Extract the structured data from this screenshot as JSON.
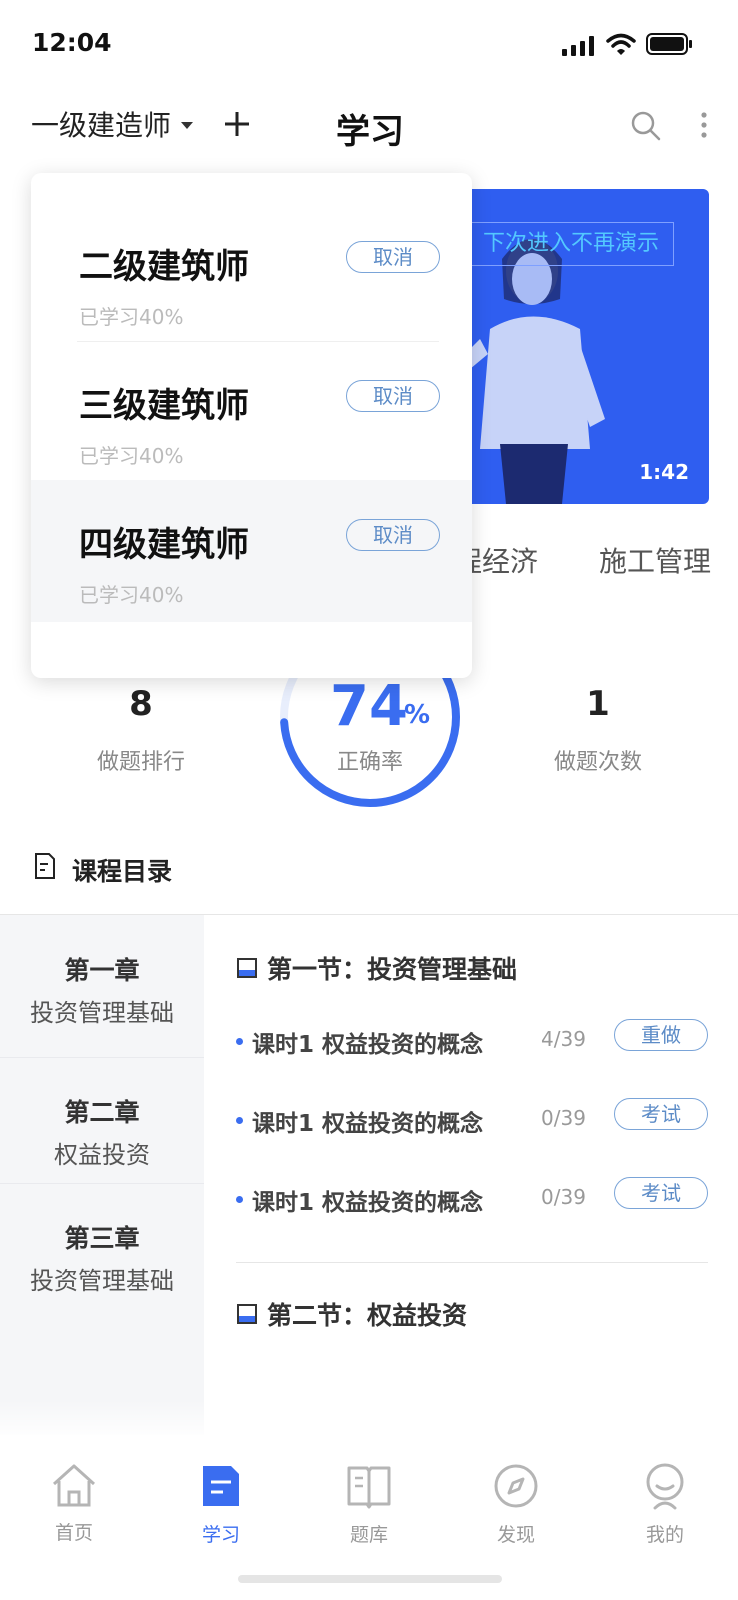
{
  "status_bar": {
    "time": "12:04"
  },
  "header": {
    "exam_selector": "一级建造师",
    "title": "学习"
  },
  "banner": {
    "hint": "下次进入不再演示",
    "duration": "1:42"
  },
  "subject_tabs": [
    "程经济",
    "施工管理"
  ],
  "stats": {
    "rank_value": "8",
    "rank_label": "做题排行",
    "accuracy_value": "74",
    "accuracy_unit": "%",
    "accuracy_fraction": 0.74,
    "accuracy_label": "正确率",
    "attempts_value": "1",
    "attempts_label": "做题次数"
  },
  "catalog": {
    "title": "课程目录",
    "chapters": [
      {
        "title": "第一章",
        "subtitle": "投资管理基础"
      },
      {
        "title": "第二章",
        "subtitle": "权益投资"
      },
      {
        "title": "第三章",
        "subtitle": "投资管理基础"
      }
    ],
    "sections": [
      {
        "title": "第一节：投资管理基础",
        "lessons": [
          {
            "name": "课时1 权益投资的概念",
            "progress": "4/39",
            "action": "重做"
          },
          {
            "name": "课时1 权益投资的概念",
            "progress": "0/39",
            "action": "考试"
          },
          {
            "name": "课时1 权益投资的概念",
            "progress": "0/39",
            "action": "考试"
          }
        ]
      },
      {
        "title": "第二节：权益投资"
      }
    ]
  },
  "bottom_nav": [
    {
      "label": "首页",
      "icon": "home-icon",
      "active": false
    },
    {
      "label": "学习",
      "icon": "study-icon",
      "active": true
    },
    {
      "label": "题库",
      "icon": "book-icon",
      "active": false
    },
    {
      "label": "发现",
      "icon": "compass-icon",
      "active": false
    },
    {
      "label": "我的",
      "icon": "profile-icon",
      "active": false
    }
  ],
  "dropdown": {
    "items": [
      {
        "title": "二级建筑师",
        "progress": "已学习40%",
        "action": "取消"
      },
      {
        "title": "三级建筑师",
        "progress": "已学习40%",
        "action": "取消"
      },
      {
        "title": "四级建筑师",
        "progress": "已学习40%",
        "action": "取消"
      }
    ]
  },
  "colors": {
    "accent": "#3a6df0",
    "banner": "#2f5ef0",
    "outline_button": "#7aa4d8"
  }
}
